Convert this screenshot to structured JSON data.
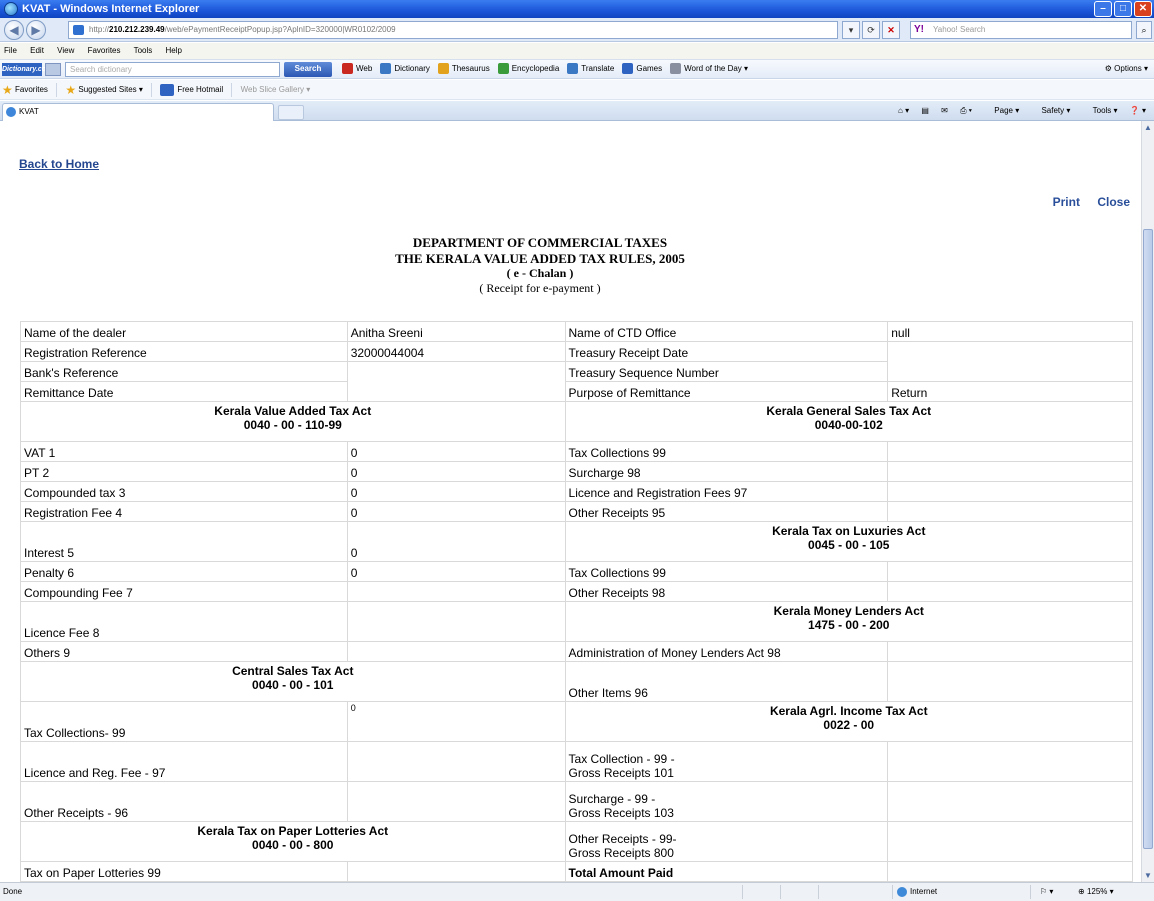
{
  "window": {
    "title": "KVAT - Windows Internet Explorer"
  },
  "address": {
    "url_prefix": "http://",
    "url_host": "210.212.239.49",
    "url_rest": "/web/ePaymentReceiptPopup.jsp?AplnID=320000|WR0102/2009",
    "search_placeholder": "Yahoo! Search"
  },
  "menu": {
    "items": [
      "File",
      "Edit",
      "View",
      "Favorites",
      "Tools",
      "Help"
    ]
  },
  "dict_toolbar": {
    "logo": "Dictionary.com",
    "placeholder": "Search dictionary",
    "search_label": "Search",
    "links": [
      {
        "label": "Web",
        "color": "#c8281f"
      },
      {
        "label": "Dictionary",
        "color": "#3b78c4"
      },
      {
        "label": "Thesaurus",
        "color": "#e2a21b"
      },
      {
        "label": "Encyclopedia",
        "color": "#3a9b3a"
      },
      {
        "label": "Translate",
        "color": "#3b78c4"
      },
      {
        "label": "Games",
        "color": "#2f63c2"
      },
      {
        "label": "Word of the Day",
        "color": "#8a8fa0"
      }
    ],
    "options_label": "Options"
  },
  "favorites_bar": {
    "favorites_label": "Favorites",
    "suggested_sites": "Suggested Sites",
    "free_hotmail": "Free Hotmail",
    "web_slice_gallery": "Web Slice Gallery"
  },
  "tab": {
    "label": "KVAT"
  },
  "commands": {
    "page": "Page",
    "safety": "Safety",
    "tools": "Tools"
  },
  "page": {
    "back_home": "Back to Home",
    "print": "Print",
    "close": "Close",
    "heading": [
      "DEPARTMENT OF COMMERCIAL TAXES",
      "THE KERALA VALUE ADDED TAX RULES, 2005",
      "( e - Chalan )",
      "( Receipt for e-payment )"
    ]
  },
  "receipt": {
    "info": {
      "dealer_label": "Name of the dealer",
      "dealer_value": "Anitha Sreeni",
      "ctd_label": "Name of CTD Office",
      "ctd_value": "null",
      "reg_label": "Registration Reference",
      "reg_value": "32000044004",
      "treasury_date_label": "Treasury Receipt Date",
      "treasury_date_value": "",
      "bank_label": "Bank's Reference",
      "bank_value": "",
      "treasury_seq_label": "Treasury Sequence Number",
      "treasury_seq_value": "",
      "remit_date_label": "Remittance Date",
      "remit_date_value": "",
      "purpose_label": "Purpose of Remittance",
      "purpose_value": "Return"
    },
    "sections": {
      "kvat": {
        "title": "Kerala Value Added Tax Act",
        "code": "0040 - 00 - 110-99"
      },
      "kgst": {
        "title": "Kerala General Sales Tax Act",
        "code": "0040-00-102"
      },
      "luxury": {
        "title": "Kerala Tax on Luxuries Act",
        "code": "0045 - 00 - 105"
      },
      "money": {
        "title": "Kerala Money Lenders Act",
        "code": "1475 - 00 - 200"
      },
      "cst": {
        "title": "Central Sales Tax Act",
        "code": "0040 - 00 - 101"
      },
      "agri": {
        "title": "Kerala Agrl. Income Tax Act",
        "code": "0022 - 00"
      },
      "lottery": {
        "title": "Kerala Tax on Paper Lotteries Act",
        "code": "0040 - 00 - 800"
      }
    },
    "rows": {
      "vat1": {
        "label": "VAT 1",
        "value": "0"
      },
      "tax_coll_99": {
        "label": "Tax Collections 99",
        "value": ""
      },
      "pt2": {
        "label": "PT 2",
        "value": "0"
      },
      "surcharge_98": {
        "label": "Surcharge 98",
        "value": ""
      },
      "compounded3": {
        "label": "Compounded tax 3",
        "value": "0"
      },
      "licence_reg_97": {
        "label": "Licence and Registration Fees 97",
        "value": ""
      },
      "regfee4": {
        "label": "Registration Fee 4",
        "value": "0"
      },
      "other_receipts_95": {
        "label": "Other Receipts 95",
        "value": ""
      },
      "interest5": {
        "label": "Interest 5",
        "value": "0"
      },
      "penalty6": {
        "label": "Penalty 6",
        "value": "0"
      },
      "lux_tax_coll_99": {
        "label": "Tax Collections 99",
        "value": ""
      },
      "compounding7": {
        "label": "Compounding Fee 7",
        "value": ""
      },
      "lux_other_98": {
        "label": "Other Receipts 98",
        "value": ""
      },
      "licencefee8": {
        "label": "Licence Fee 8",
        "value": ""
      },
      "others9": {
        "label": "Others 9",
        "value": ""
      },
      "admin_money_98": {
        "label": "Administration of Money Lenders Act 98",
        "value": ""
      },
      "other_items_96": {
        "label": "Other Items 96",
        "value": ""
      },
      "cst_tax_coll_99": {
        "label": "Tax Collections- 99",
        "value": "0"
      },
      "agri_tax_coll_line1": {
        "label": "Tax Collection - 99 -"
      },
      "agri_tax_coll_line2": {
        "label": "Gross Receipts 101"
      },
      "cst_licence_97": {
        "label": "Licence and Reg. Fee - 97",
        "value": ""
      },
      "agri_surcharge_line1": {
        "label": "Surcharge - 99 -"
      },
      "agri_surcharge_line2": {
        "label": "Gross Receipts 103"
      },
      "cst_other_96": {
        "label": "Other Receipts - 96",
        "value": ""
      },
      "agri_other_line1": {
        "label": "Other Receipts - 99-"
      },
      "agri_other_line2": {
        "label": "Gross Receipts 800"
      },
      "lottery_99": {
        "label": "Tax on Paper Lotteries 99",
        "value": ""
      },
      "total": {
        "label": "Total Amount Paid",
        "value": ""
      }
    }
  },
  "status": {
    "left": "Done",
    "zone": "Internet",
    "zoom": "125%"
  }
}
